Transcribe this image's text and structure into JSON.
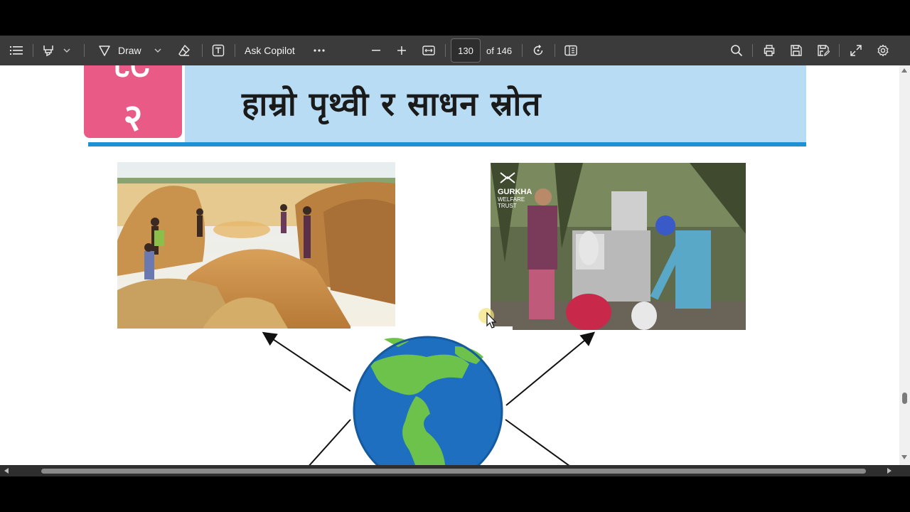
{
  "toolbar": {
    "draw_label": "Draw",
    "copilot_label": "Ask Copilot",
    "current_page": "130",
    "page_total": "of 146"
  },
  "document": {
    "chapter_number": "२",
    "chapter_title": "हाम्रो पृथ्वी र साधन स्रोत",
    "watermark_line1": "GURKHA",
    "watermark_line2": "WELFARE",
    "watermark_line3": "TRUST"
  },
  "colors": {
    "toolbar_bg": "#3b3b3b",
    "chapter_pink": "#ea5a86",
    "title_band": "#b7dcf3",
    "title_underline": "#1f8fd6",
    "ocean": "#1e6fc0",
    "land": "#6cc24a"
  },
  "icons": [
    "contents-icon",
    "highlighter-icon",
    "draw-icon",
    "eraser-icon",
    "text-box-icon",
    "more-icon",
    "zoom-out-icon",
    "zoom-in-icon",
    "fit-width-icon",
    "rotate-icon",
    "page-view-icon",
    "search-icon",
    "print-icon",
    "save-icon",
    "save-as-icon",
    "fullscreen-icon",
    "settings-icon"
  ]
}
